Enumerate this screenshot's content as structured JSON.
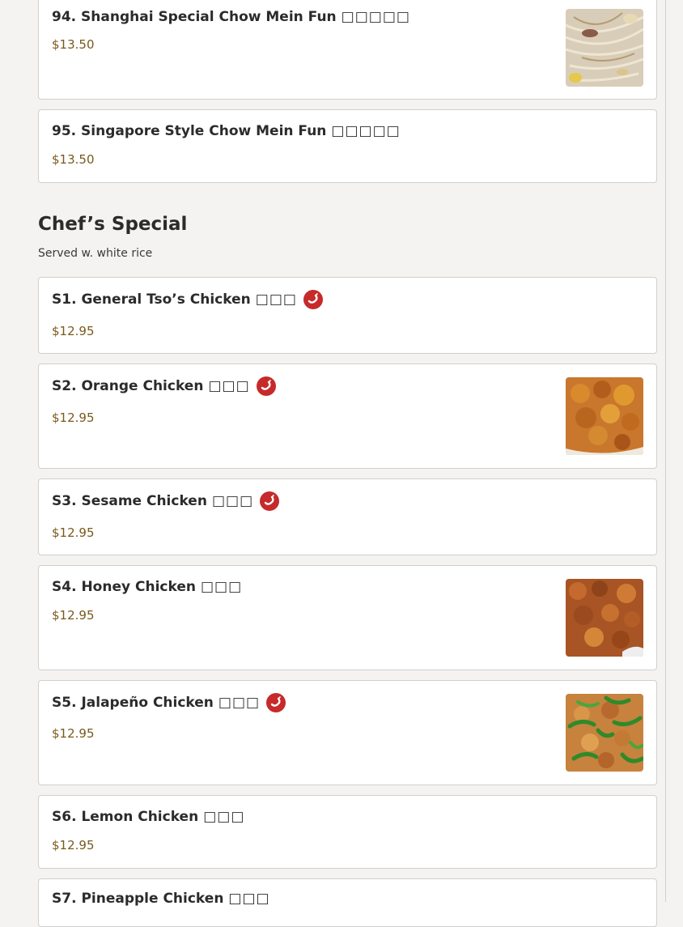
{
  "noodles": {
    "items": [
      {
        "name": "94. Shanghai Special Chow Mein Fun",
        "cn": "□□□□□",
        "price": "$13.50"
      },
      {
        "name": "95. Singapore Style Chow Mein Fun",
        "cn": "□□□□□",
        "price": "$13.50"
      }
    ]
  },
  "chefs_special": {
    "title": "Chef’s Special",
    "subtitle": "Served w. white rice",
    "items": [
      {
        "name": "S1. General Tso’s Chicken",
        "cn": "□□□",
        "price": "$12.95",
        "spicy": true
      },
      {
        "name": "S2. Orange Chicken",
        "cn": "□□□",
        "price": "$12.95",
        "spicy": true
      },
      {
        "name": "S3. Sesame Chicken",
        "cn": "□□□",
        "price": "$12.95",
        "spicy": true
      },
      {
        "name": "S4. Honey Chicken",
        "cn": "□□□",
        "price": "$12.95",
        "spicy": false
      },
      {
        "name": "S5. Jalapeño Chicken",
        "cn": "□□□",
        "price": "$12.95",
        "spicy": true
      },
      {
        "name": "S6. Lemon Chicken",
        "cn": "□□□",
        "price": "$12.95",
        "spicy": false
      },
      {
        "name": "S7. Pineapple Chicken",
        "cn": "□□□",
        "price": "",
        "spicy": false
      }
    ]
  },
  "icons": {
    "spicy": "chili-pepper-icon"
  },
  "colors": {
    "spicy_badge": "#c62a2a",
    "price": "#7a5a1c"
  }
}
